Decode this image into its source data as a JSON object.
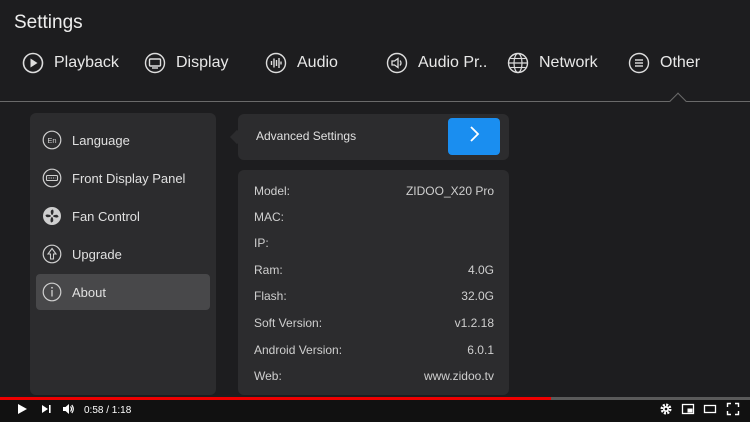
{
  "window": {
    "title": "Settings"
  },
  "tabs": [
    {
      "label": "Playback",
      "icon": "play-circle-icon"
    },
    {
      "label": "Display",
      "icon": "monitor-icon"
    },
    {
      "label": "Audio",
      "icon": "audio-wave-icon"
    },
    {
      "label": "Audio Pr..",
      "icon": "speaker-icon"
    },
    {
      "label": "Network",
      "icon": "globe-icon"
    },
    {
      "label": "Other",
      "icon": "list-icon",
      "selected": true
    }
  ],
  "menu": [
    {
      "label": "Language",
      "icon": "language-icon",
      "icon_text": "En"
    },
    {
      "label": "Front Display Panel",
      "icon": "front-panel-icon"
    },
    {
      "label": "Fan Control",
      "icon": "fan-icon"
    },
    {
      "label": "Upgrade",
      "icon": "upgrade-icon"
    },
    {
      "label": "About",
      "icon": "info-icon",
      "selected": true
    }
  ],
  "advanced": {
    "label": "Advanced Settings",
    "button_icon": "chevron-right-icon"
  },
  "about": [
    {
      "key": "Model:",
      "value": "ZIDOO_X20 Pro"
    },
    {
      "key": "MAC:",
      "value": ""
    },
    {
      "key": "IP:",
      "value": ""
    },
    {
      "key": "Ram:",
      "value": "4.0G"
    },
    {
      "key": "Flash:",
      "value": "32.0G"
    },
    {
      "key": "Soft Version:",
      "value": "v1.2.18"
    },
    {
      "key": "Android Version:",
      "value": "6.0.1"
    },
    {
      "key": "Web:",
      "value": "www.zidoo.tv"
    }
  ],
  "player": {
    "time": "0:58 / 1:18",
    "progress": 0.735,
    "colors": {
      "progress": "#ee0000",
      "accent": "#1a8ef0"
    }
  }
}
